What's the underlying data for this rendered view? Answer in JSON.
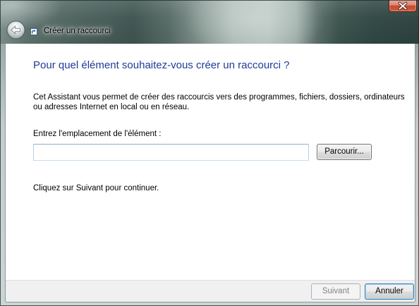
{
  "window": {
    "title": "Créer un raccourci"
  },
  "icons": {
    "close": "close-icon",
    "back": "back-arrow-icon",
    "app": "shortcut-icon"
  },
  "wizard": {
    "heading": "Pour quel élément souhaitez-vous créer un raccourci ?",
    "description": "Cet Assistant vous permet de créer des raccourcis vers des programmes, fichiers, dossiers, ordinateurs ou adresses Internet en local ou en réseau.",
    "location_label": "Entrez l'emplacement de l'élément :",
    "location_value": "",
    "browse_label": "Parcourir...",
    "continue_hint": "Cliquez sur Suivant pour continuer."
  },
  "footer": {
    "next_label": "Suivant",
    "next_enabled": false,
    "cancel_label": "Annuler",
    "cancel_is_default": true
  },
  "colors": {
    "heading_text": "#1e3c96",
    "glass_dark": "#2f4642",
    "close_button": "#c74a2f",
    "default_button_border": "#3c7fb1"
  }
}
